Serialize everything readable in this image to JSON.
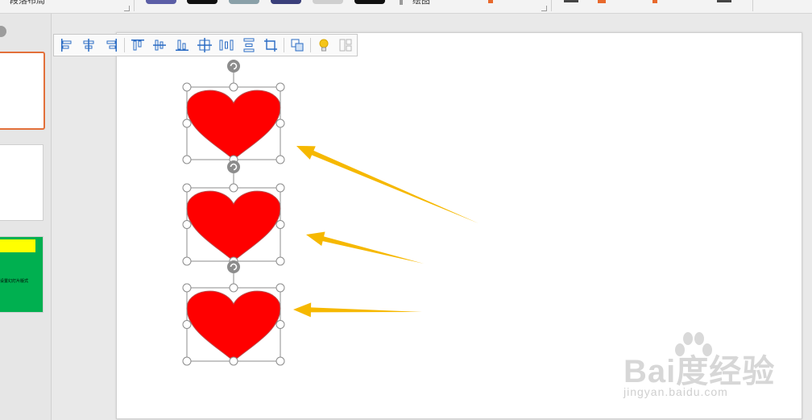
{
  "ribbon": {
    "labels": [
      "段落布局",
      "绘图"
    ]
  },
  "slides": {
    "thumb3_text": "设置幻灯片版式"
  },
  "align_toolbar": {
    "buttons": [
      {
        "name": "align-left-icon"
      },
      {
        "name": "align-center-icon"
      },
      {
        "name": "align-right-icon"
      },
      {
        "name": "align-top-icon"
      },
      {
        "name": "align-middle-icon"
      },
      {
        "name": "align-bottom-icon"
      },
      {
        "name": "align-slide-center-icon"
      },
      {
        "name": "distribute-horizontal-icon"
      },
      {
        "name": "distribute-vertical-icon"
      },
      {
        "name": "crop-icon"
      },
      {
        "name": "group-icon"
      },
      {
        "name": "lightbulb-icon"
      },
      {
        "name": "more-layout-icon"
      }
    ]
  },
  "shapes": {
    "heart_color": "#ff0000",
    "heart_outline": "#b94c4c",
    "arrow_color": "#f6b800",
    "handle_color": "#8c8c8c",
    "count": 3
  },
  "watermark": {
    "brand": "Bai度经验",
    "url": "jingyan.baidu.com"
  },
  "colors": {
    "selected_thumb_border": "#e2703a",
    "thumb3_bg": "#00b050",
    "thumb3_bar": "#ffff00"
  }
}
